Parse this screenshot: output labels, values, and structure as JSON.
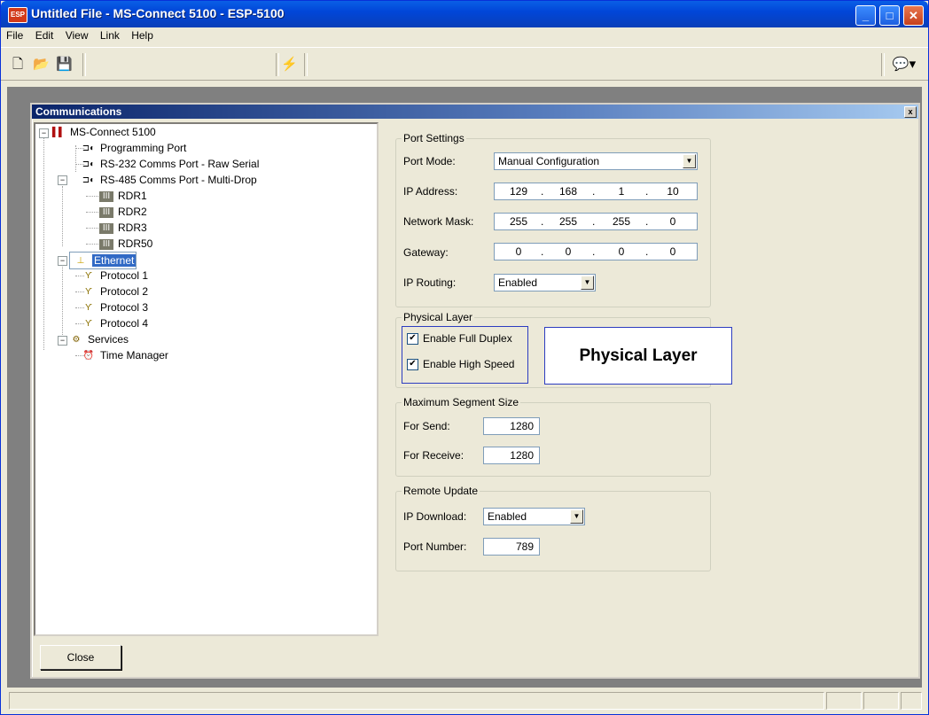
{
  "window": {
    "title": "Untitled File - MS-Connect 5100 - ESP-5100",
    "app_icon_text": "ESP"
  },
  "menu": [
    "File",
    "Edit",
    "View",
    "Link",
    "Help"
  ],
  "toolbar": {
    "icons": [
      "new-file-icon",
      "open-folder-icon",
      "save-icon",
      "connect-lightning-icon",
      "comment-icon"
    ]
  },
  "child": {
    "title": "Communications",
    "close_glyph": "x"
  },
  "tree": {
    "root": "MS-Connect 5100",
    "programming_port": "Programming Port",
    "rs232": "RS-232 Comms Port - Raw Serial",
    "rs485": "RS-485 Comms Port - Multi-Drop",
    "readers": [
      "RDR1",
      "RDR2",
      "RDR3",
      "RDR50"
    ],
    "ethernet": "Ethernet",
    "protocols": [
      "Protocol 1",
      "Protocol 2",
      "Protocol 3",
      "Protocol 4"
    ],
    "services": "Services",
    "time_manager": "Time Manager"
  },
  "close_button": {
    "label": "Close"
  },
  "port_settings": {
    "group_label": "Port Settings",
    "port_mode_label": "Port Mode:",
    "port_mode_value": "Manual Configuration",
    "ip_address_label": "IP Address:",
    "ip_address": [
      "129",
      "168",
      "1",
      "10"
    ],
    "network_mask_label": "Network Mask:",
    "network_mask": [
      "255",
      "255",
      "255",
      "0"
    ],
    "gateway_label": "Gateway:",
    "gateway": [
      "0",
      "0",
      "0",
      "0"
    ],
    "ip_routing_label": "IP Routing:",
    "ip_routing_value": "Enabled"
  },
  "physical_layer": {
    "group_label": "Physical Layer",
    "full_duplex_label": "Enable Full Duplex",
    "full_duplex_checked": true,
    "high_speed_label": "Enable High Speed",
    "high_speed_checked": true,
    "callout": "Physical Layer"
  },
  "segment_size": {
    "group_label": "Maximum Segment Size",
    "send_label": "For Send:",
    "send_value": "1280",
    "receive_label": "For Receive:",
    "receive_value": "1280"
  },
  "remote_update": {
    "group_label": "Remote Update",
    "ip_download_label": "IP Download:",
    "ip_download_value": "Enabled",
    "port_number_label": "Port Number:",
    "port_number_value": "789"
  },
  "colors": {
    "title_blue": "#0146d8",
    "selection": "#316ac5",
    "callout_border": "#2c3cc0"
  }
}
